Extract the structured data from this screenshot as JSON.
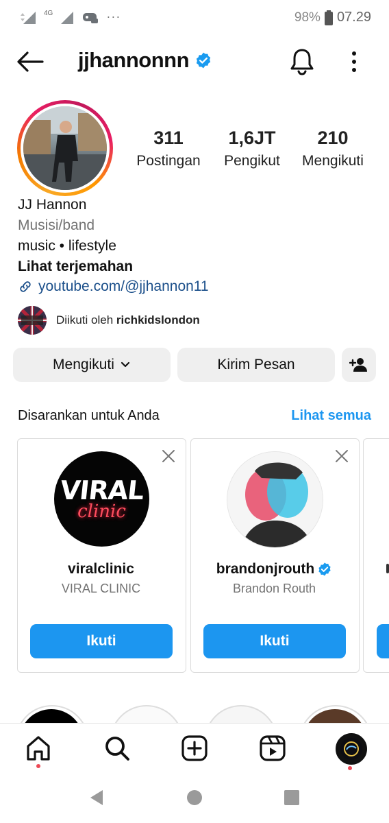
{
  "status_bar": {
    "battery": "98%",
    "time": "07.29",
    "network": "4G",
    "more": "···"
  },
  "header": {
    "username": "jjhannonnn",
    "verified": true
  },
  "profile": {
    "stats": [
      {
        "value": "311",
        "label": "Postingan"
      },
      {
        "value": "1,6JT",
        "label": "Pengikut"
      },
      {
        "value": "210",
        "label": "Mengikuti"
      }
    ],
    "name": "JJ Hannon",
    "category": "Musisi/band",
    "bio": "music • lifestyle",
    "translate": "Lihat terjemahan",
    "link": "youtube.com/@jjhannon11",
    "followed_by_prefix": "Diikuti oleh",
    "followed_by_user": "richkidslondon"
  },
  "actions": {
    "following": "Mengikuti",
    "message": "Kirim Pesan"
  },
  "suggestions": {
    "title": "Disarankan untuk Anda",
    "see_all": "Lihat semua",
    "cards": [
      {
        "username": "viralclinic",
        "name": "VIRAL CLINIC",
        "button": "Ikuti",
        "logo_line1": "VIRAL",
        "logo_line2": "clinic",
        "verified": false
      },
      {
        "username": "brandonjrouth",
        "name": "Brandon Routh",
        "button": "Ikuti",
        "verified": true
      }
    ]
  },
  "colors": {
    "accent": "#1c96f0",
    "verified": "#1a9bf0",
    "link": "#1b4f8a"
  }
}
